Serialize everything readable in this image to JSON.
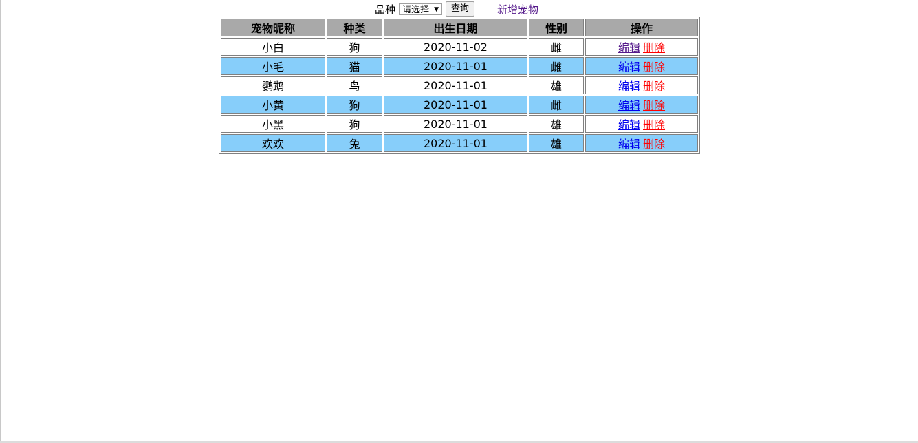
{
  "search": {
    "label": "品种",
    "select_value": "请选择",
    "button_label": "查询",
    "add_link": "新增宠物"
  },
  "table": {
    "headers": [
      "宠物昵称",
      "种类",
      "出生日期",
      "性别",
      "操作"
    ],
    "rows": [
      {
        "name": "小白",
        "kind": "狗",
        "birth": "2020-11-02",
        "gender": "雌",
        "edit": "编辑",
        "delete": "删除"
      },
      {
        "name": "小毛",
        "kind": "猫",
        "birth": "2020-11-01",
        "gender": "雌",
        "edit": "编辑",
        "delete": "删除"
      },
      {
        "name": "鹦鹉",
        "kind": "鸟",
        "birth": "2020-11-01",
        "gender": "雄",
        "edit": "编辑",
        "delete": "删除"
      },
      {
        "name": "小黄",
        "kind": "狗",
        "birth": "2020-11-01",
        "gender": "雌",
        "edit": "编辑",
        "delete": "删除"
      },
      {
        "name": "小黑",
        "kind": "狗",
        "birth": "2020-11-01",
        "gender": "雄",
        "edit": "编辑",
        "delete": "删除"
      },
      {
        "name": "欢欢",
        "kind": "兔",
        "birth": "2020-11-01",
        "gender": "雄",
        "edit": "编辑",
        "delete": "删除"
      }
    ]
  },
  "colors": {
    "header_bg": "#a9a9a9",
    "row_alt_bg": "#87cefa",
    "row_bg": "#ffffff",
    "delete_link": "#ff0000",
    "edit_link": "#0000ee"
  }
}
